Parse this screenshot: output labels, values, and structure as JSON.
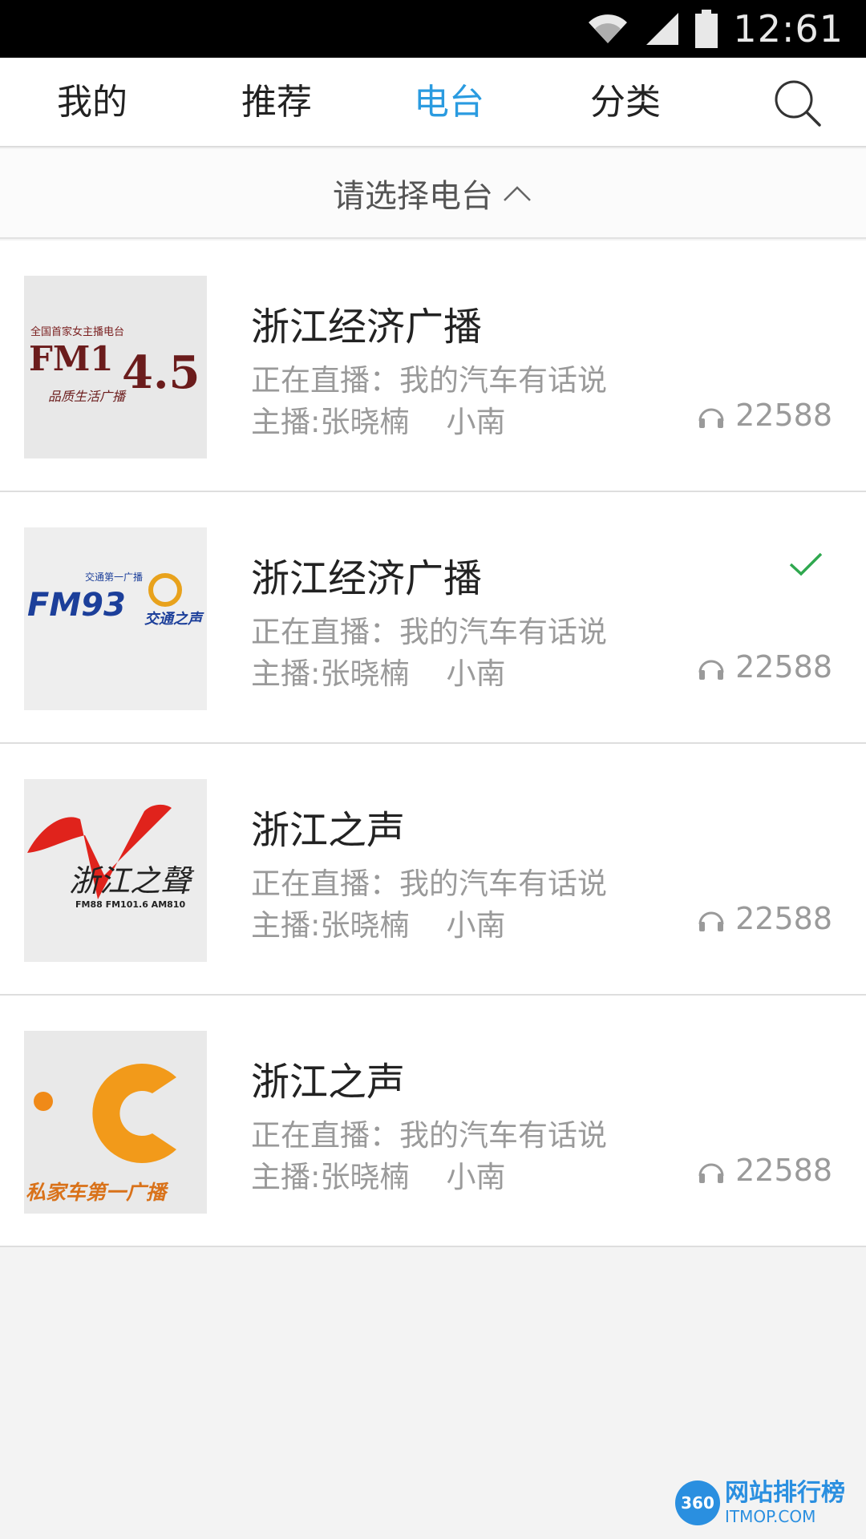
{
  "status_bar": {
    "time": "12:61",
    "icons": [
      "wifi-icon",
      "signal-icon",
      "battery-icon"
    ]
  },
  "nav": {
    "tabs": [
      {
        "label": "我的",
        "active": false
      },
      {
        "label": "推荐",
        "active": false
      },
      {
        "label": "电台",
        "active": true
      },
      {
        "label": "分类",
        "active": false
      }
    ],
    "search_icon": "search-icon"
  },
  "picker": {
    "label": "请选择电台",
    "icon": "chevron-up-icon"
  },
  "stations": [
    {
      "name": "浙江经济广播",
      "live": "正在直播：我的汽车有话说",
      "host": "主播:张晓楠",
      "cohost": "小南",
      "listeners": "22588",
      "selected": false,
      "logo_text": {
        "top": "全国首家女主播电台",
        "main": "FM1",
        "num": "4.5",
        "sub": "品质生活广播"
      }
    },
    {
      "name": "浙江经济广播",
      "live": "正在直播：我的汽车有话说",
      "host": "主播:张晓楠",
      "cohost": "小南",
      "listeners": "22588",
      "selected": true,
      "logo_text": {
        "top": "交通第一广播",
        "main": "FM93",
        "sub": "交通之声"
      }
    },
    {
      "name": "浙江之声",
      "live": "正在直播：我的汽车有话说",
      "host": "主播:张晓楠",
      "cohost": "小南",
      "listeners": "22588",
      "selected": false,
      "logo_text": {
        "main": "浙江之聲",
        "sub": "FM88 FM101.6 AM810"
      }
    },
    {
      "name": "浙江之声",
      "live": "正在直播：我的汽车有话说",
      "host": "主播:张晓楠",
      "cohost": "小南",
      "listeners": "22588",
      "selected": false,
      "logo_text": {
        "sub": "私家车第一广播"
      }
    }
  ],
  "watermark": {
    "badge": "360",
    "title": "网站排行榜",
    "sub": "ITMOP.COM"
  },
  "colors": {
    "accent": "#2a9be0",
    "check": "#2fa84f",
    "muted": "#9a9a9a"
  }
}
